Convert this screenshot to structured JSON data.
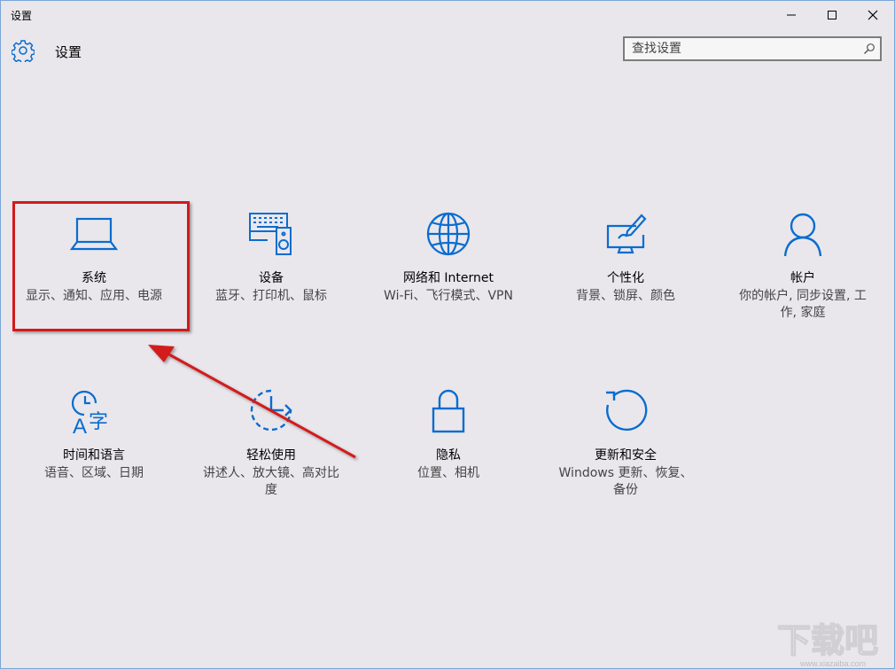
{
  "window": {
    "title": "设置",
    "buttons": [
      "minimize",
      "maximize",
      "close"
    ]
  },
  "header": {
    "title": "设置",
    "icon": "gear-icon"
  },
  "search": {
    "placeholder": "查找设置",
    "icon": "search-icon"
  },
  "tiles": [
    {
      "id": "system",
      "title": "系统",
      "desc": "显示、通知、应用、电源",
      "icon": "laptop-icon"
    },
    {
      "id": "devices",
      "title": "设备",
      "desc": "蓝牙、打印机、鼠标",
      "icon": "devices-icon"
    },
    {
      "id": "network",
      "title": "网络和 Internet",
      "desc": "Wi-Fi、飞行模式、VPN",
      "icon": "globe-icon"
    },
    {
      "id": "personalization",
      "title": "个性化",
      "desc": "背景、锁屏、颜色",
      "icon": "personalization-icon"
    },
    {
      "id": "accounts",
      "title": "帐户",
      "desc": "你的帐户, 同步设置, 工作, 家庭",
      "icon": "user-icon"
    },
    {
      "id": "time-language",
      "title": "时间和语言",
      "desc": "语音、区域、日期",
      "icon": "time-language-icon"
    },
    {
      "id": "ease-of-access",
      "title": "轻松使用",
      "desc": "讲述人、放大镜、高对比度",
      "icon": "ease-of-access-icon"
    },
    {
      "id": "privacy",
      "title": "隐私",
      "desc": "位置、相机",
      "icon": "lock-icon"
    },
    {
      "id": "update-security",
      "title": "更新和安全",
      "desc": "Windows 更新、恢复、备份",
      "icon": "refresh-icon"
    }
  ],
  "annotation": {
    "highlight_color": "#d21a1a",
    "target": "system"
  },
  "watermark": {
    "text": "下载吧",
    "url": "www.xiazaiba.com"
  },
  "colors": {
    "accent": "#0a6ccf",
    "background": "#e9e7ec"
  }
}
